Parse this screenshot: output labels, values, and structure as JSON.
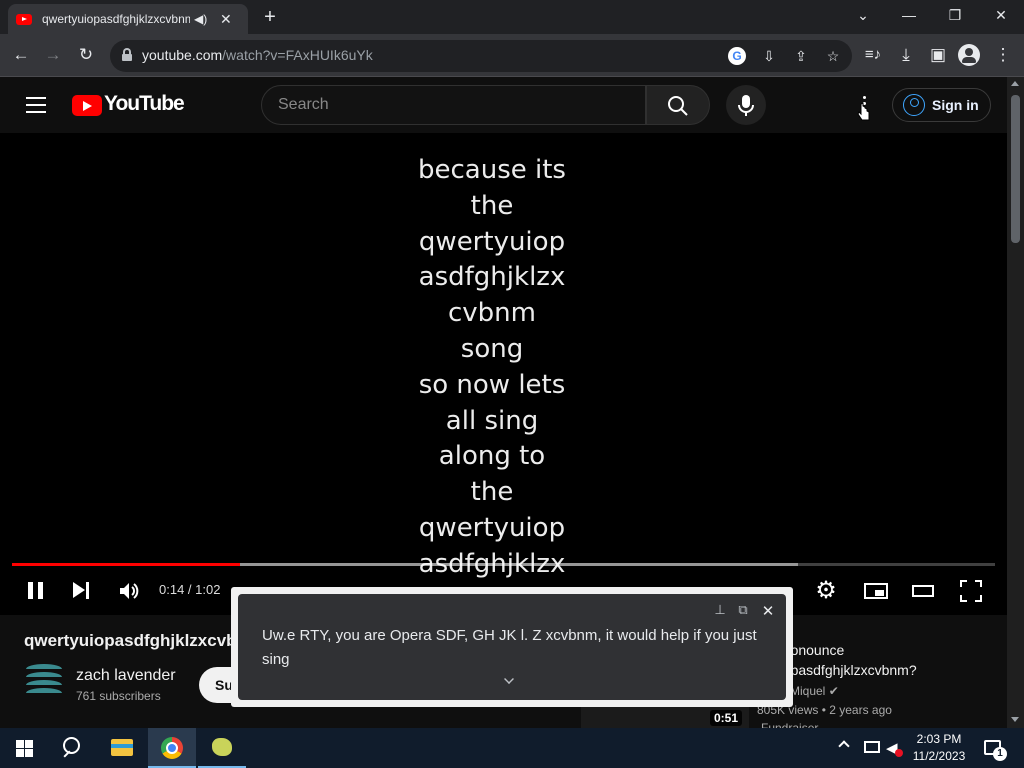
{
  "browser": {
    "tab_title": "qwertyuiopasdfghjklzxcvbnm",
    "tab_audio_icon": "speaker-icon",
    "url_domain": "youtube.com",
    "url_path": "/watch?v=FAxHUIk6uYk",
    "window_controls": [
      "minimize",
      "restore",
      "close"
    ]
  },
  "youtube": {
    "brand": "YouTube",
    "search_placeholder": "Search",
    "sign_in_label": "Sign in"
  },
  "player": {
    "lyrics": [
      "because its",
      "the",
      "qwertyuiop",
      "asdfghjklzx",
      "cvbnm",
      "song",
      "so now lets",
      "all sing",
      "along to",
      "the",
      "qwertyuiop",
      "asdfghjklzx"
    ],
    "time_current": "0:14",
    "time_total": "1:02",
    "time_display": "0:14 / 1:02",
    "played_fraction": 0.232,
    "buffered_fraction": 0.8,
    "state": "playing"
  },
  "video": {
    "title": "qwertyuiopasdfghjklzxcvbnm",
    "channel": "zach lavender",
    "subscribers": "761 subscribers",
    "subscribe_label": "Su"
  },
  "recommendation": {
    "title_line1": "to Pronounce",
    "title_line2": "tyuiopasdfghjklzxcvbnm?",
    "channel": "Miquel",
    "views": "805K views",
    "age": "2 years ago",
    "meta": "805K views • 2 years ago",
    "extra": "Fundraiser",
    "duration": "0:51"
  },
  "live_caption": {
    "text": "Uw.e RTY, you are Opera SDF, GH JK l. Z xcvbnm, it would help if you just sing"
  },
  "taskbar": {
    "time": "2:03 PM",
    "date": "11/2/2023",
    "notification_count": "1"
  },
  "colors": {
    "youtube_red": "#ff0000",
    "accent_blue": "#3ea6ff",
    "chrome_dark": "#202124",
    "taskbar": "#101c2c"
  }
}
